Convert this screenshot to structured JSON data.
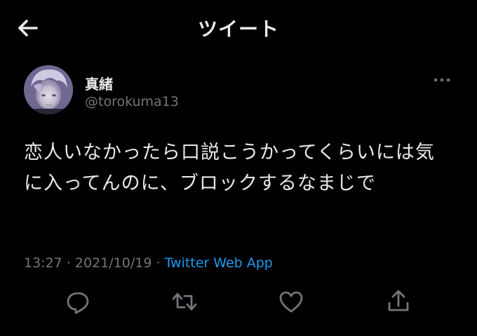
{
  "header": {
    "title": "ツイート",
    "back_icon": "arrow-left-icon"
  },
  "author": {
    "display_name": "真緒",
    "handle": "@torokuma13",
    "more_icon": "more-horizontal-icon"
  },
  "tweet": {
    "text": "恋人いなかったら口説こうかってくらいには気に入ってんのに、ブロックするなまじで",
    "time": "13:27",
    "date": "2021/10/19",
    "separator": "·",
    "source": "Twitter Web App"
  },
  "actions": [
    {
      "name": "reply",
      "icon": "reply-icon"
    },
    {
      "name": "retweet",
      "icon": "retweet-icon"
    },
    {
      "name": "like",
      "icon": "heart-icon"
    },
    {
      "name": "share",
      "icon": "share-icon"
    }
  ],
  "colors": {
    "background": "#000000",
    "text": "#e7e9ea",
    "secondary": "#71767b",
    "link": "#1d9bf0"
  }
}
